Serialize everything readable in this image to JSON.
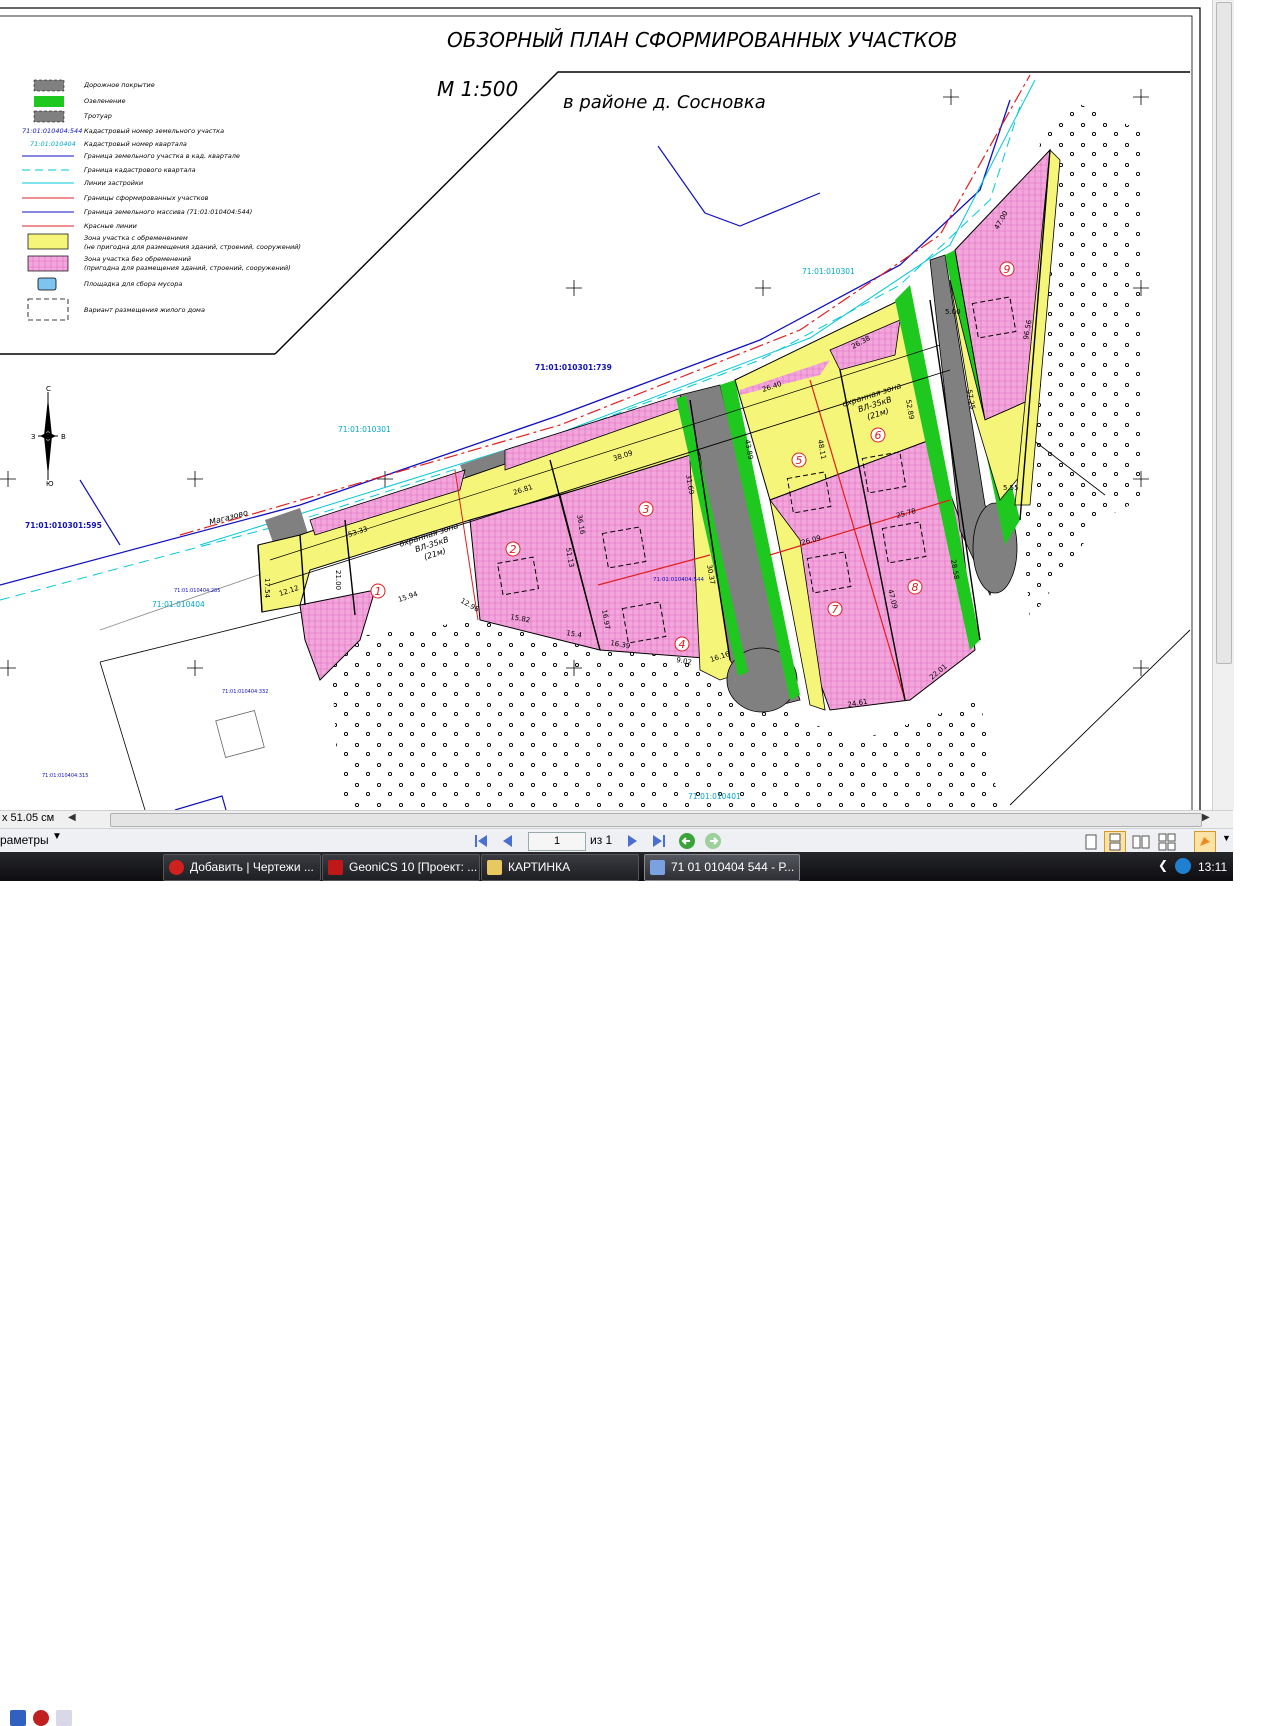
{
  "drawing": {
    "title": "ОБЗОРНЫЙ ПЛАН СФОРМИРОВАННЫХ УЧАСТКОВ",
    "scale": "М 1:500",
    "location": "в районе д. Сосновка",
    "legend": [
      "Дорожное покрытие",
      "Озеленение",
      "Тротуар",
      "71:01:010404:544",
      "Кадастровый номер земельного участка",
      "71:01:010404",
      "Кадастровый номер квартала",
      "Граница земельного участка в кад. квартале",
      "Граница кадастрового квартала",
      "Линии застройки",
      "Границы сформированных участков",
      "Граница земельного массива (71:01:010404:544)",
      "Красные линии",
      "Зона участка с обременением",
      "(не пригодна для размещения зданий, строений, сооружений)",
      "Зона участка без обременений",
      "(пригодна для размещения зданий, строений, сооружений)",
      "Площадка для сбора мусора",
      "Вариант размещения жилого дома"
    ],
    "compass": {
      "n": "С",
      "s": "Ю",
      "w": "З",
      "e": "В"
    },
    "cadastral_labels": [
      "71:01:010301:739",
      "71:01:010301:595",
      "71:01:010301",
      "71:01:010301",
      "71:01:010404",
      "71:01:010401",
      "71:01:010404:544",
      "71:01:010404:285",
      "71:01:010404:332",
      "71:01:010404:315"
    ],
    "road_name": "Магазово",
    "zone_text": [
      "охранная зона",
      "ВЛ-35кВ",
      "(21м)"
    ],
    "plot_numbers": [
      "1",
      "2",
      "3",
      "4",
      "5",
      "6",
      "7",
      "8",
      "9"
    ],
    "dimensions": [
      "53.33",
      "21.00",
      "17.54",
      "12.12",
      "15.94",
      "12.96",
      "15.82",
      "15.4",
      "16.39",
      "16.97",
      "26.81",
      "38.09",
      "36.16",
      "51.13",
      "31.69",
      "30.37",
      "9.02",
      "16.16",
      "26.40",
      "26.38",
      "26.09",
      "25.78",
      "48.11",
      "43.89",
      "47.09",
      "24.61",
      "22.01",
      "47.00",
      "96.56",
      "5.00",
      "5.55",
      "28.58",
      "57.25",
      "52.89"
    ]
  },
  "statusbar": {
    "coords": "x 51.05 см",
    "params": "раметры",
    "page_current": "1",
    "page_total": "из 1"
  },
  "taskbar": {
    "tasks": [
      "Добавить | Чертежи ...",
      "GeoniCS 10 [Проект: ...",
      "КАРТИНКА",
      "71 01 010404 544 - Р..."
    ],
    "time": "13:11"
  },
  "colors": {
    "yellow_zone": "#f5f57a",
    "pink_zone": "#f0a8dc",
    "road": "#808080",
    "green": "#1ec81e",
    "red_line": "#e02020",
    "cyan_line": "#00c8d8",
    "blue_line": "#1010c0"
  }
}
